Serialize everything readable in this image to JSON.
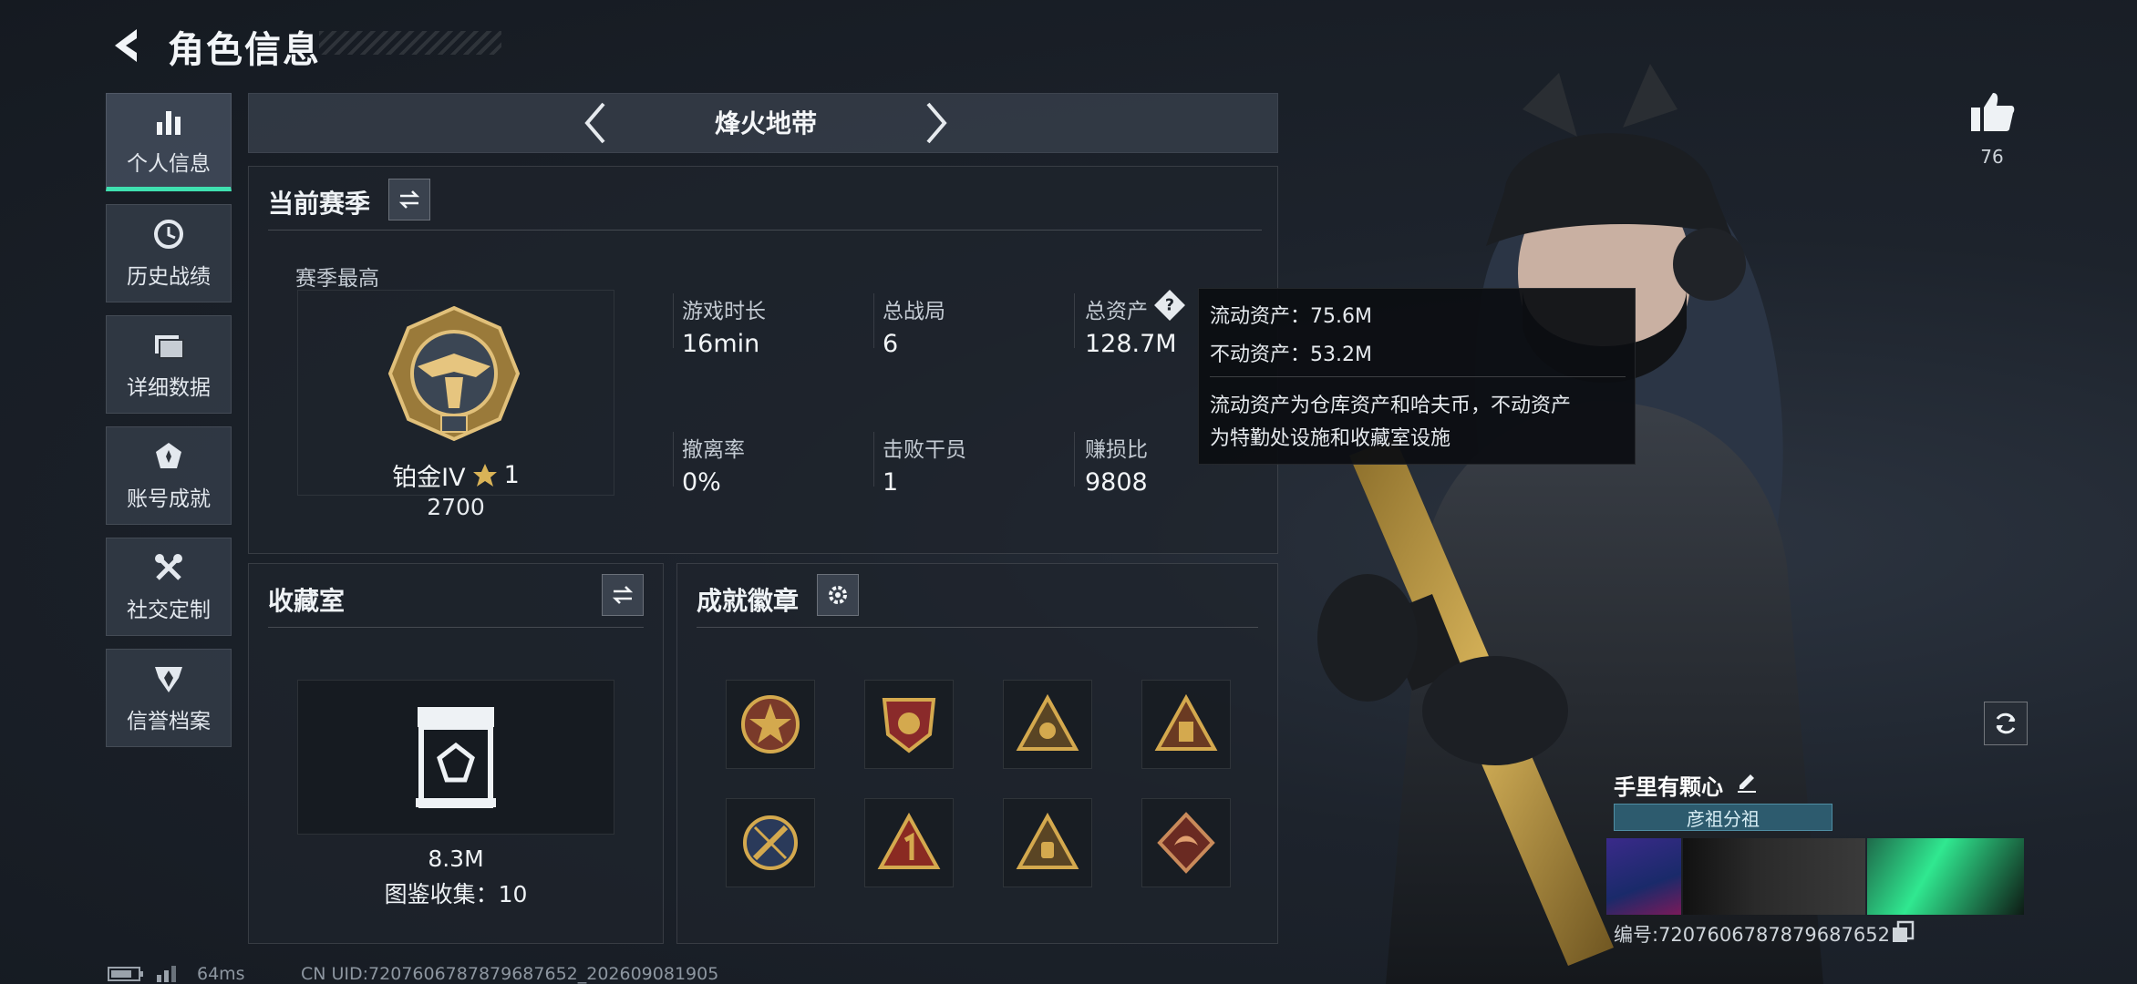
{
  "header": {
    "title": "角色信息"
  },
  "sidebar": {
    "items": [
      {
        "label": "个人信息",
        "icon": "bar-chart-icon",
        "active": true
      },
      {
        "label": "历史战绩",
        "icon": "clock-icon",
        "active": false
      },
      {
        "label": "详细数据",
        "icon": "folder-icon",
        "active": false
      },
      {
        "label": "账号成就",
        "icon": "medal-icon",
        "active": false
      },
      {
        "label": "社交定制",
        "icon": "tools-icon",
        "active": false
      },
      {
        "label": "信誉档案",
        "icon": "shield-wing-icon",
        "active": false
      }
    ]
  },
  "mode": {
    "name": "烽火地带"
  },
  "season": {
    "title": "当前赛季",
    "best_label": "赛季最高",
    "rank_name": "铂金IV",
    "rank_stars": "1",
    "rank_score": "2700",
    "stats": [
      {
        "label": "游戏时长",
        "value": "16min"
      },
      {
        "label": "总战局",
        "value": "6"
      },
      {
        "label": "总资产",
        "value": "128.7M"
      },
      {
        "label": "撤离率",
        "value": "0%"
      },
      {
        "label": "击败干员",
        "value": "1"
      },
      {
        "label": "赚损比",
        "value": "9808"
      }
    ]
  },
  "tooltip": {
    "liquid": "流动资产：75.6M",
    "fixed": "不动资产：53.2M",
    "desc1": "流动资产为仓库资产和哈夫币，不动资产",
    "desc2": "为特勤处设施和收藏室设施"
  },
  "collection": {
    "title": "收藏室",
    "value": "8.3M",
    "catalog": "图鉴收集：10"
  },
  "badges": {
    "title": "成就徽章",
    "items": [
      "star-badge-icon",
      "shield-badge-icon",
      "triangle-emblem-icon",
      "triangle-tower-icon",
      "sword-badge-icon",
      "number-one-icon",
      "triangle-lantern-icon",
      "dragon-badge-icon"
    ]
  },
  "profile": {
    "likes": "76",
    "name": "手里有颗心",
    "title_plate": "彦祖分祖",
    "id": "编号:7207606787879687652"
  },
  "footer": {
    "ping": "64ms",
    "uid": "CN UID:7207606787879687652_202609081905"
  },
  "colors": {
    "accent": "#3fe0b0",
    "gold": "#d4a94e",
    "panel": "#1e242c"
  }
}
